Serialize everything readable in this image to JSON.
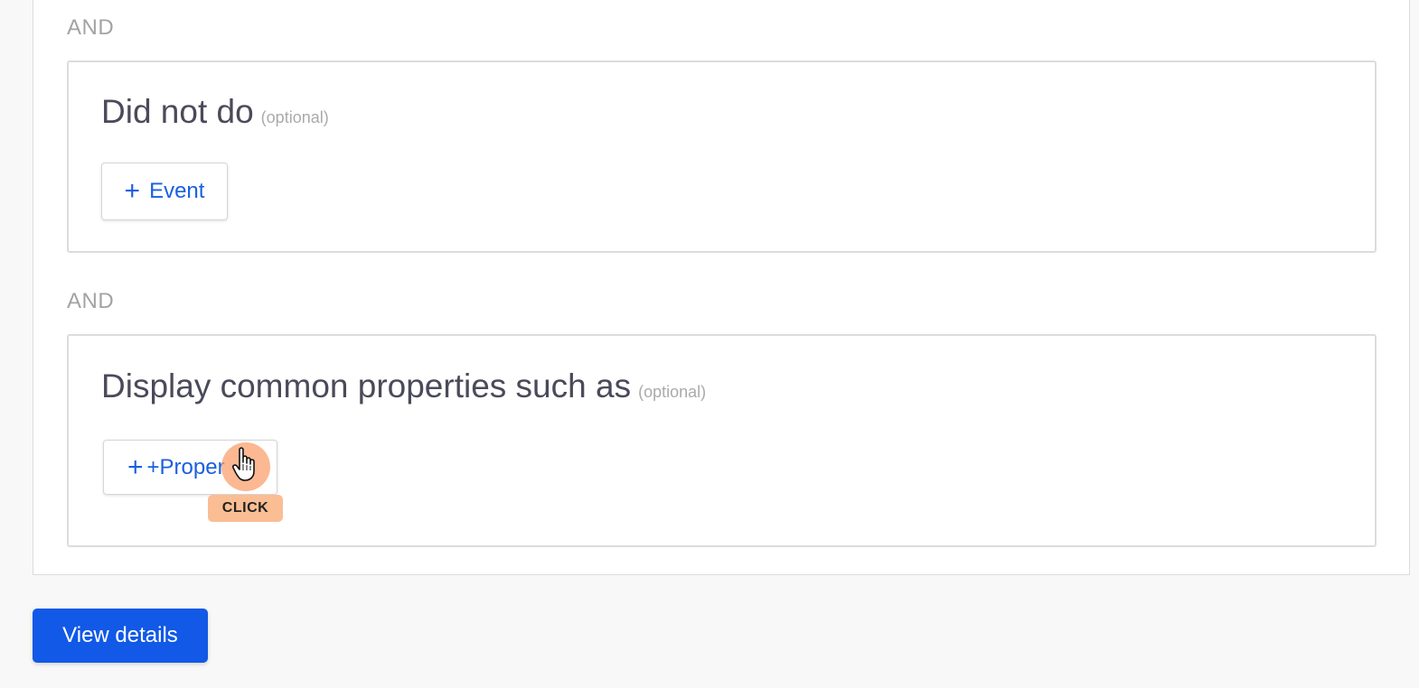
{
  "conditions": {
    "and_label_1": "AND",
    "and_label_2": "AND",
    "did_not_do": {
      "title": "Did not do",
      "optional": "(optional)",
      "add_button_label": "Event"
    },
    "common_properties": {
      "title": "Display common properties such as",
      "optional": "(optional)",
      "add_button_label": "+Proper"
    }
  },
  "cursor": {
    "action_label": "CLICK"
  },
  "footer": {
    "view_details_label": "View details"
  },
  "icons": {
    "add": "plus-icon",
    "cursor": "hand-pointer-icon"
  },
  "colors": {
    "accent": "#1159e6",
    "link_blue": "#1a5fe0",
    "cursor_highlight": "#fbbd93"
  }
}
